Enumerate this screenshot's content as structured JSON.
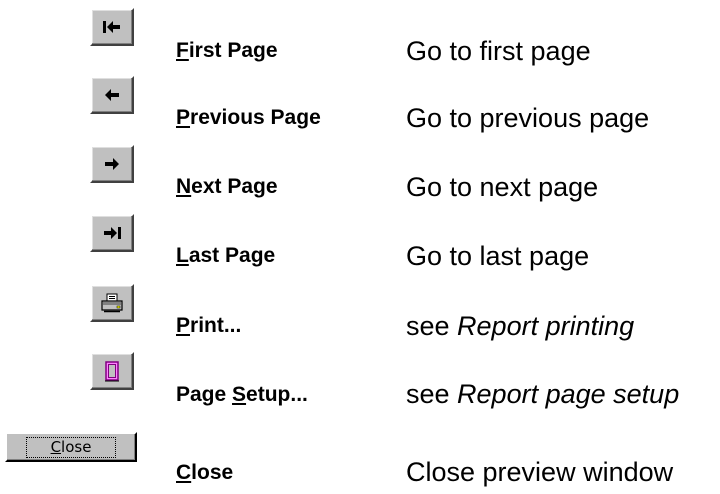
{
  "rows": [
    {
      "icon": "first-page-icon",
      "label_key": "F",
      "label_rest": "irst Page",
      "description": "Go to first page"
    },
    {
      "icon": "previous-page-icon",
      "label_key": "P",
      "label_rest": "revious Page",
      "description": "Go to previous page"
    },
    {
      "icon": "next-page-icon",
      "label_key": "N",
      "label_rest": "ext Page",
      "description": "Go to next page"
    },
    {
      "icon": "last-page-icon",
      "label_key": "L",
      "label_rest": "ast Page",
      "description": "Go to last page"
    },
    {
      "icon": "printer-icon",
      "label_key": "P",
      "label_rest": "rint...",
      "description_prefix": "see ",
      "description_link": "Report printing"
    },
    {
      "icon": "page-setup-icon",
      "label_prefix": "Page ",
      "label_key": "S",
      "label_rest": "etup...",
      "description_prefix": "see ",
      "description_link": "Report page setup"
    },
    {
      "button_key": "C",
      "button_rest": "lose",
      "label_key": "C",
      "label_rest": "lose",
      "description": "Close preview window"
    }
  ],
  "colors": {
    "button_face": "#c0c0c0",
    "page_setup_icon": "#800080"
  }
}
